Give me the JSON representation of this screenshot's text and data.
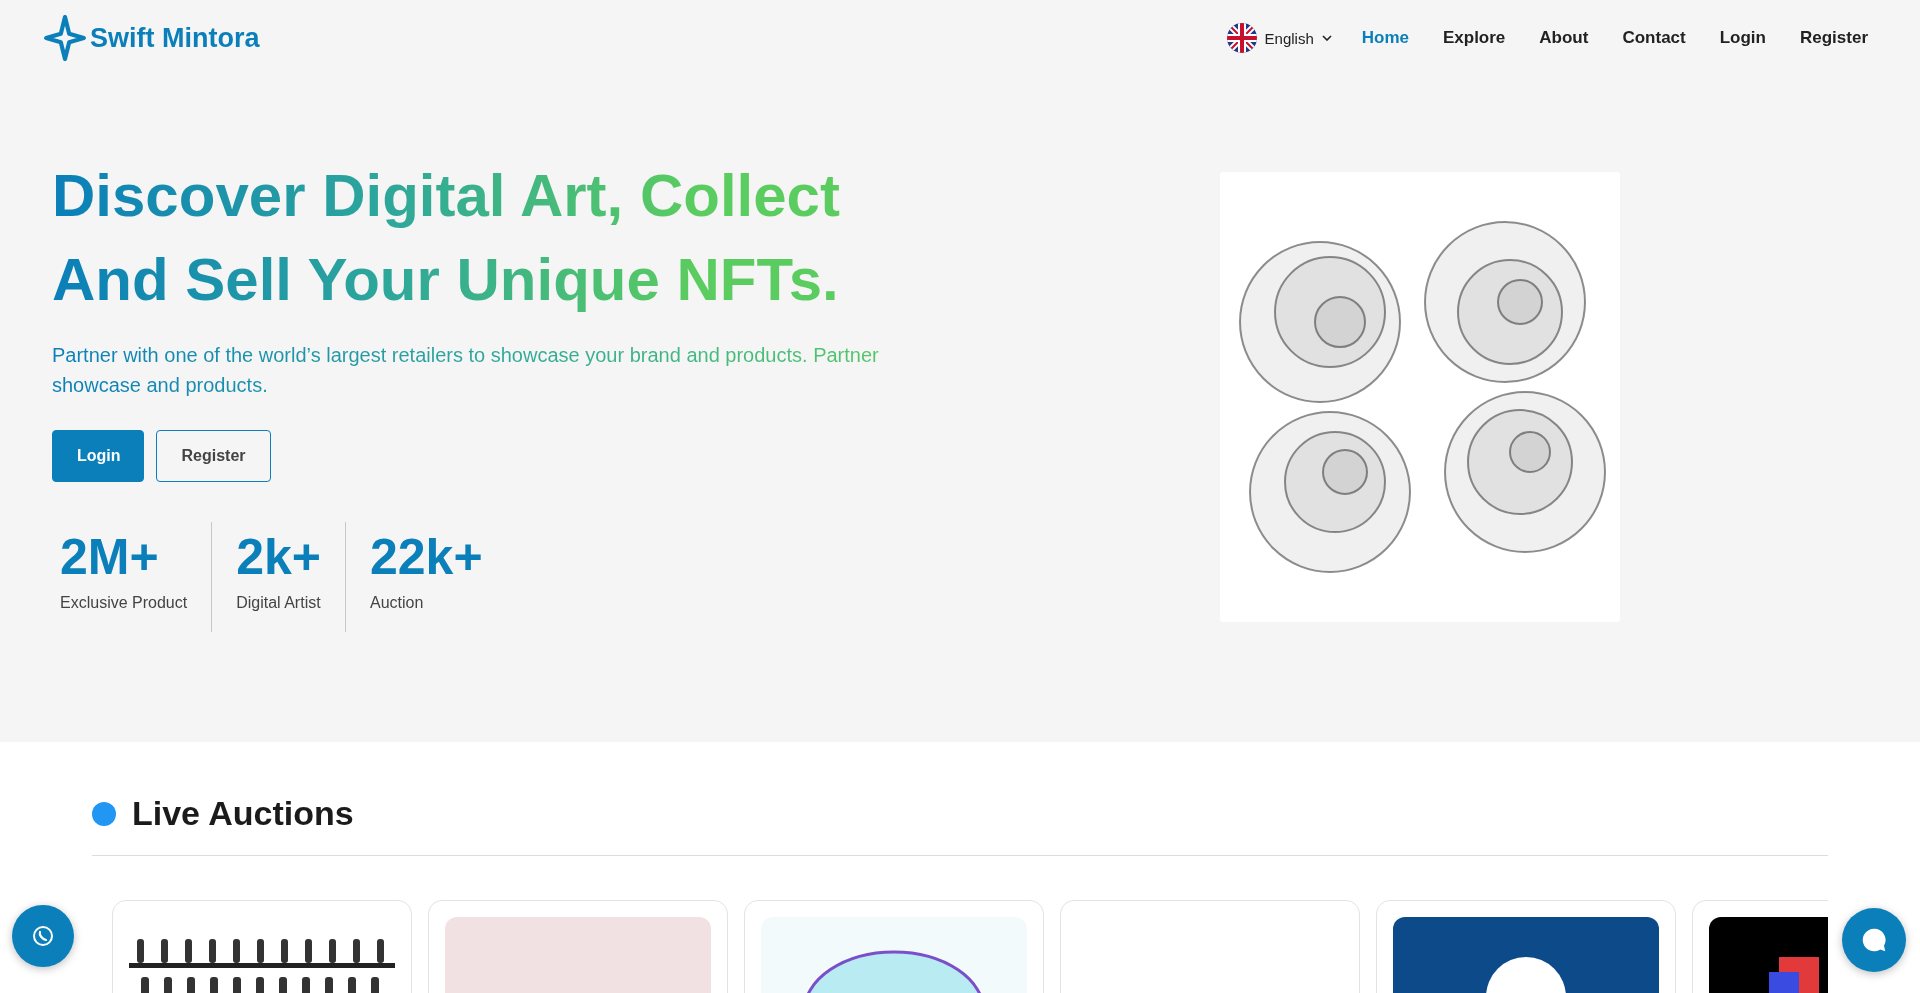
{
  "brand": {
    "name": "Swift Mintora"
  },
  "language": {
    "label": "English"
  },
  "nav": [
    {
      "label": "Home",
      "selected": true
    },
    {
      "label": "Explore",
      "selected": false
    },
    {
      "label": "About",
      "selected": false
    },
    {
      "label": "Contact",
      "selected": false
    },
    {
      "label": "Login",
      "selected": false
    },
    {
      "label": "Register",
      "selected": false
    }
  ],
  "hero": {
    "headline_lines": [
      "Discover Digital Art, Collect",
      "And Sell Your Unique NFTs."
    ],
    "text": "Partner with one of the world’s largest retailers to showcase your brand and products. Partner showcase and products.",
    "buttons": [
      {
        "label": "Login",
        "kind": "primary"
      },
      {
        "label": "Register",
        "kind": "outline"
      }
    ],
    "stats": [
      {
        "value": "2M+",
        "label": "Exclusive Product"
      },
      {
        "value": "2k+",
        "label": "Digital Artist"
      },
      {
        "value": "22k+",
        "label": "Auction"
      }
    ]
  },
  "live_auctions": {
    "title": "Live Auctions",
    "cards": [
      {
        "kind": "picture"
      },
      {
        "kind": "picture"
      },
      {
        "kind": "picture"
      },
      {
        "kind": "blank"
      },
      {
        "kind": "picture"
      },
      {
        "kind": "picture"
      }
    ]
  }
}
